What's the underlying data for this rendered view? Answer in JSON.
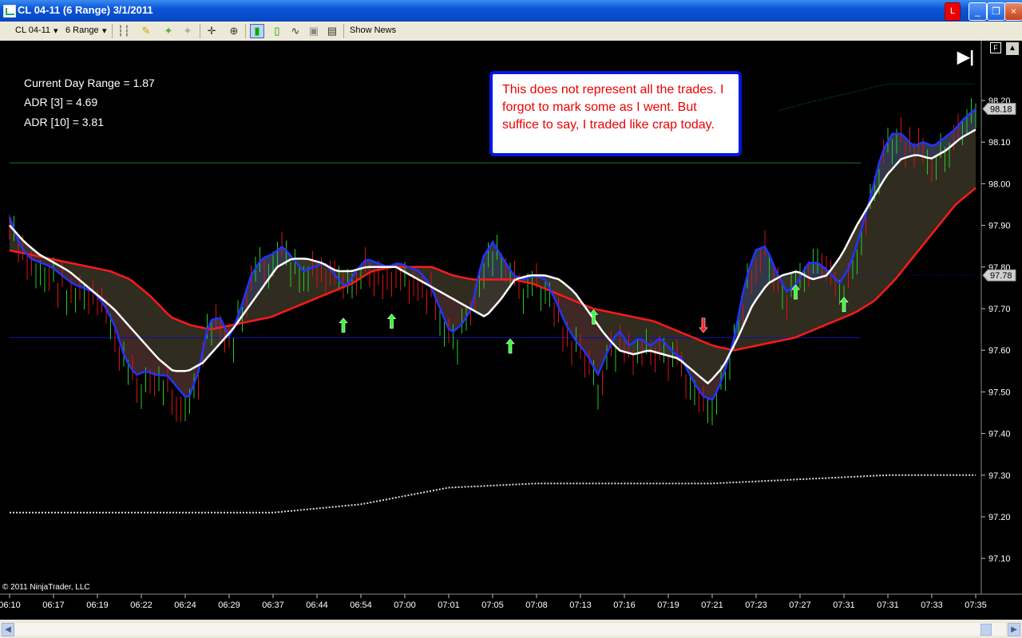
{
  "window": {
    "title": "CL 04-11 (6 Range)  3/1/2011",
    "link_label": "L",
    "min_label": "_",
    "max_label": "❐",
    "close_label": "×"
  },
  "toolbar": {
    "instrument": "CL 04-11",
    "instrument_arrow": "▾",
    "interval": "6 Range",
    "interval_arrow": "▾",
    "show_news": "Show News"
  },
  "stats": {
    "current_day_range": "Current Day Range = 1.87",
    "adr3": "ADR [3] = 4.69",
    "adr10": "ADR [10] = 3.81"
  },
  "annotation": "This does not represent all the trades. I forgot to mark some as I went. But suffice to say, I traded like crap today.",
  "copyright": "© 2011 NinjaTrader, LLC",
  "controls": {
    "end_label": "▶|",
    "f_label": "F",
    "scroll_up": "▲"
  },
  "scrollbar": {
    "left": "◀",
    "right": "▶"
  },
  "colors": {
    "up_bar": "#22cc22",
    "down_bar": "#dd1111",
    "fast_ma": "#2233ff",
    "slow_ma": "#ff1a1a",
    "mid_ma": "#ffffff",
    "green_line": "#0d7a3a",
    "blue_line": "#1010aa"
  },
  "chart_data": {
    "type": "candlestick",
    "instrument": "CL 04-11",
    "interval": "6 Range",
    "date": "3/1/2011",
    "y_ticks": [
      "98.20",
      "98.10",
      "98.00",
      "97.90",
      "97.80",
      "97.70",
      "97.60",
      "97.50",
      "97.40",
      "97.30",
      "97.20",
      "97.10"
    ],
    "ylim": [
      97.04,
      98.26
    ],
    "price_markers": [
      {
        "label": "98.18",
        "value": 98.18
      },
      {
        "label": "97.78",
        "value": 97.78
      }
    ],
    "x_ticks": [
      "06:10",
      "06:17",
      "06:19",
      "06:22",
      "06:24",
      "06:29",
      "06:37",
      "06:44",
      "06:54",
      "07:00",
      "07:01",
      "07:05",
      "07:08",
      "07:13",
      "07:16",
      "07:19",
      "07:21",
      "07:23",
      "07:27",
      "07:31",
      "07:31",
      "07:33",
      "07:35"
    ],
    "bar_count": 221,
    "series": [
      {
        "key": "fast_ma",
        "values": [
          97.92,
          97.85,
          97.82,
          97.81,
          97.8,
          97.78,
          97.76,
          97.75,
          97.74,
          97.71,
          97.66,
          97.58,
          97.54,
          97.55,
          97.54,
          97.54,
          97.51,
          97.48,
          97.55,
          97.67,
          97.68,
          97.63,
          97.7,
          97.78,
          97.82,
          97.83,
          97.85,
          97.82,
          97.79,
          97.8,
          97.81,
          97.78,
          97.75,
          97.79,
          97.82,
          97.81,
          97.8,
          97.81,
          97.8,
          97.79,
          97.76,
          97.7,
          97.64,
          97.66,
          97.7,
          97.82,
          97.86,
          97.82,
          97.78,
          97.77,
          97.78,
          97.77,
          97.72,
          97.66,
          97.62,
          97.59,
          97.54,
          97.6,
          97.65,
          97.61,
          97.63,
          97.61,
          97.63,
          97.6,
          97.58,
          97.53,
          97.49,
          97.48,
          97.54,
          97.63,
          97.76,
          97.84,
          97.85,
          97.79,
          97.74,
          97.76,
          97.81,
          97.81,
          97.79,
          97.76,
          97.8,
          97.88,
          97.97,
          98.07,
          98.12,
          98.12,
          98.09,
          98.1,
          98.09,
          98.11,
          98.13,
          98.16,
          98.18
        ]
      },
      {
        "key": "mid_ma",
        "values": [
          97.9,
          97.86,
          97.83,
          97.81,
          97.79,
          97.76,
          97.73,
          97.7,
          97.66,
          97.62,
          97.58,
          97.55,
          97.55,
          97.57,
          97.61,
          97.65,
          97.7,
          97.75,
          97.8,
          97.82,
          97.82,
          97.81,
          97.79,
          97.79,
          97.8,
          97.8,
          97.8,
          97.78,
          97.76,
          97.74,
          97.72,
          97.7,
          97.68,
          97.72,
          97.77,
          97.78,
          97.78,
          97.77,
          97.74,
          97.69,
          97.64,
          97.6,
          97.59,
          97.6,
          97.59,
          97.58,
          97.55,
          97.52,
          97.56,
          97.63,
          97.71,
          97.76,
          97.78,
          97.79,
          97.77,
          97.78,
          97.83,
          97.9,
          97.96,
          98.02,
          98.06,
          98.07,
          98.06,
          98.08,
          98.11,
          98.13
        ]
      },
      {
        "key": "slow_ma",
        "values": [
          97.84,
          97.83,
          97.82,
          97.81,
          97.8,
          97.79,
          97.77,
          97.73,
          97.68,
          97.66,
          97.65,
          97.66,
          97.67,
          97.68,
          97.7,
          97.72,
          97.74,
          97.76,
          97.79,
          97.8,
          97.8,
          97.8,
          97.78,
          97.77,
          97.77,
          97.77,
          97.76,
          97.74,
          97.72,
          97.7,
          97.69,
          97.68,
          97.67,
          97.65,
          97.63,
          97.61,
          97.6,
          97.61,
          97.62,
          97.63,
          97.65,
          97.67,
          97.69,
          97.72,
          97.77,
          97.83,
          97.89,
          97.95,
          97.99
        ]
      },
      {
        "key": "upper_step",
        "values": [
          98.05,
          98.05,
          98.05,
          98.05,
          98.12,
          98.13,
          98.13,
          98.13,
          98.13,
          98.19,
          98.24,
          98.24
        ]
      },
      {
        "key": "lower_step",
        "values": [
          97.63,
          97.63,
          97.63,
          97.63,
          97.69,
          97.75,
          97.77,
          97.77,
          97.77,
          97.78,
          97.78,
          97.78
        ]
      },
      {
        "key": "dotted_white",
        "values": [
          97.21,
          97.21,
          97.21,
          97.21,
          97.23,
          97.27,
          97.28,
          97.28,
          97.28,
          97.29,
          97.3,
          97.3
        ]
      }
    ],
    "trade_arrows": [
      {
        "time_index": 76,
        "direction": "up",
        "price": 97.66
      },
      {
        "time_index": 87,
        "direction": "up",
        "price": 97.67
      },
      {
        "time_index": 114,
        "direction": "up",
        "price": 97.61
      },
      {
        "time_index": 133,
        "direction": "up",
        "price": 97.68
      },
      {
        "time_index": 158,
        "direction": "down",
        "price": 97.66
      },
      {
        "time_index": 179,
        "direction": "up",
        "price": 97.74
      },
      {
        "time_index": 190,
        "direction": "up",
        "price": 97.71
      }
    ]
  }
}
